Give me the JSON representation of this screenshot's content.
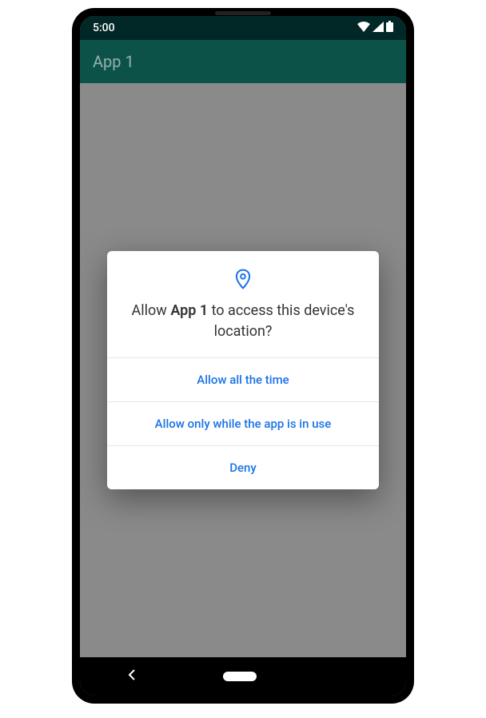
{
  "status_bar": {
    "time": "5:00"
  },
  "app_bar": {
    "title": "App 1"
  },
  "dialog": {
    "title_prefix": "Allow ",
    "title_app_name": "App 1",
    "title_suffix": " to access this device's location?",
    "buttons": {
      "allow_always": "Allow all the time",
      "allow_in_use": "Allow only while the app is in use",
      "deny": "Deny"
    }
  },
  "colors": {
    "accent": "#1a73e8",
    "toolbar": "#0d5249"
  }
}
